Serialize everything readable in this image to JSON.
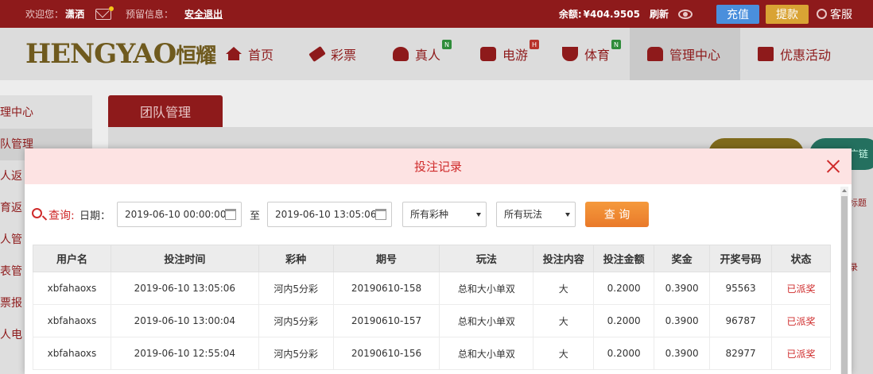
{
  "topbar": {
    "welcome": "欢迎您：",
    "username": "潇洒",
    "reserve_info": "预留信息：",
    "logout": "安全退出",
    "balance_label": "余额:",
    "balance": "¥404.9505",
    "refresh": "刷新",
    "recharge": "充值",
    "withdraw": "提款",
    "customer_service": "客服"
  },
  "logo": {
    "text": "HENGYAO",
    "cn": "恒耀"
  },
  "nav": {
    "items": [
      {
        "label": "首页",
        "icon": "home-icon"
      },
      {
        "label": "彩票",
        "icon": "ticket-icon"
      },
      {
        "label": "真人",
        "icon": "person-icon",
        "badge": "N"
      },
      {
        "label": "电游",
        "icon": "game-icon",
        "badge": "H"
      },
      {
        "label": "体育",
        "icon": "trophy-icon",
        "badge": "N"
      },
      {
        "label": "管理中心",
        "icon": "people-icon"
      },
      {
        "label": "优惠活动",
        "icon": "gift-icon"
      }
    ]
  },
  "sidebar": {
    "items": [
      {
        "label": "理中心"
      },
      {
        "label": "队管理"
      },
      {
        "label": "人返"
      },
      {
        "label": "育返"
      },
      {
        "label": "人管"
      },
      {
        "label": "表管"
      },
      {
        "label": "票报"
      },
      {
        "label": "人电"
      }
    ]
  },
  "page": {
    "tab_label": "团队管理",
    "right_side_1": "广链",
    "right_side_2": "标题",
    "right_side_3": "录"
  },
  "modal": {
    "title": "投注记录",
    "query_label": "查询:",
    "date_label": "日期：",
    "date_from": "2019-06-10 00:00:00",
    "to_label": "至",
    "date_to": "2019-06-10 13:05:06",
    "lottery_select": "所有彩种",
    "play_select": "所有玩法",
    "query_button": "查 询",
    "columns": [
      "用户名",
      "投注时间",
      "彩种",
      "期号",
      "玩法",
      "投注内容",
      "投注金额",
      "奖金",
      "开奖号码",
      "状态"
    ],
    "rows": [
      [
        "xbfahaoxs",
        "2019-06-10 13:05:06",
        "河内5分彩",
        "20190610-158",
        "总和大小单双",
        "大",
        "0.2000",
        "0.3900",
        "95563",
        "已派奖"
      ],
      [
        "xbfahaoxs",
        "2019-06-10 13:00:04",
        "河内5分彩",
        "20190610-157",
        "总和大小单双",
        "大",
        "0.2000",
        "0.3900",
        "96787",
        "已派奖"
      ],
      [
        "xbfahaoxs",
        "2019-06-10 12:55:04",
        "河内5分彩",
        "20190610-156",
        "总和大小单双",
        "大",
        "0.2000",
        "0.3900",
        "82977",
        "已派奖"
      ]
    ]
  }
}
